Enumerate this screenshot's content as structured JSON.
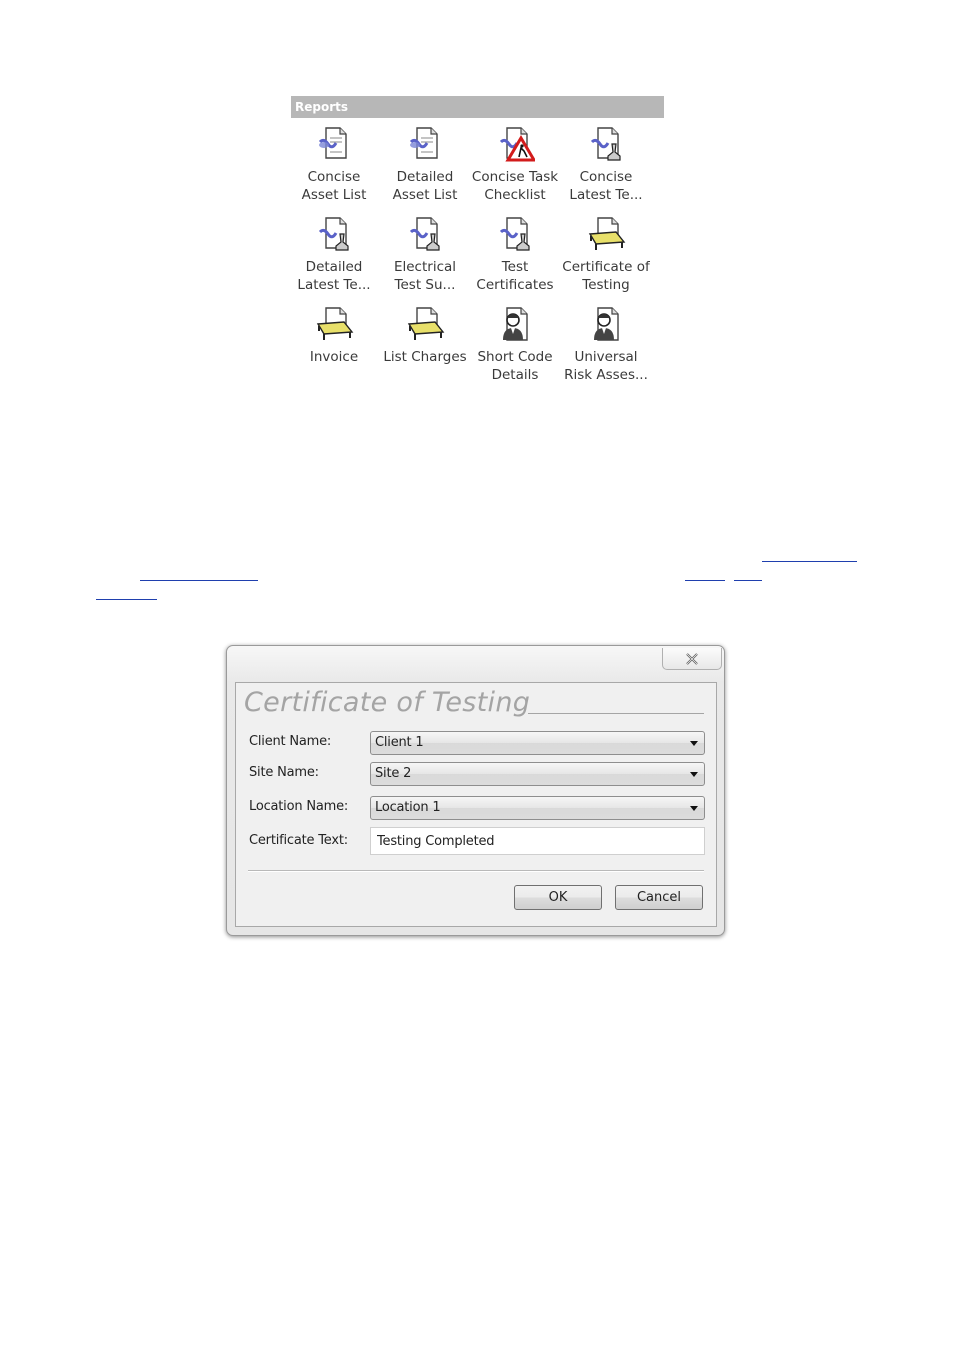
{
  "reports": {
    "header": "Reports",
    "items": [
      {
        "label": "Concise\nAsset List",
        "icon": "document-chart-icon"
      },
      {
        "label": "Detailed\nAsset List",
        "icon": "document-chart-icon"
      },
      {
        "label": "Concise Task\nChecklist",
        "icon": "document-warning-icon"
      },
      {
        "label": "Concise\nLatest Te...",
        "icon": "document-chart-stamp-icon"
      },
      {
        "label": "Detailed\nLatest Te...",
        "icon": "document-chart-stamp-icon"
      },
      {
        "label": "Electrical\nTest Su...",
        "icon": "document-chart-stamp-icon"
      },
      {
        "label": "Test\nCertificates",
        "icon": "document-chart-stamp-icon"
      },
      {
        "label": "Certificate of\nTesting",
        "icon": "document-table-icon"
      },
      {
        "label": "Invoice",
        "icon": "document-table-icon"
      },
      {
        "label": "List Charges",
        "icon": "document-table-icon"
      },
      {
        "label": "Short Code\nDetails",
        "icon": "document-person-icon"
      },
      {
        "label": "Universal\nRisk Asses...",
        "icon": "document-person-icon"
      }
    ]
  },
  "dialog": {
    "title": "Certificate of Testing",
    "client_label": "Client Name:",
    "client_value": "Client 1",
    "site_label": "Site Name:",
    "site_value": "Site 2",
    "location_label": "Location Name:",
    "location_value": "Location 1",
    "cert_text_label": "Certificate Text:",
    "cert_text_value": "Testing Completed",
    "ok_label": "OK",
    "cancel_label": "Cancel",
    "close_icon": "close-icon"
  },
  "colors": {
    "header_bg": "#b7b7b7",
    "link": "#1f3fae",
    "title_gray": "#a4a4a4"
  }
}
